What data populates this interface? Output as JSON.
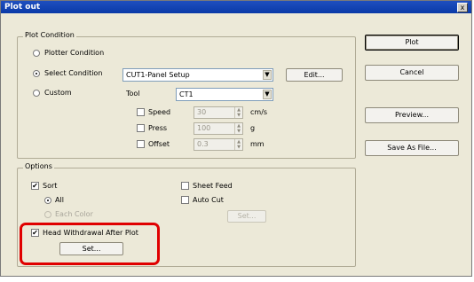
{
  "window": {
    "title": "Plot out",
    "close_glyph": "x"
  },
  "background_fragments": [
    "t",
    "l"
  ],
  "plot_condition": {
    "legend": "Plot Condition",
    "plotter_condition": "Plotter Condition",
    "select_condition": "Select Condition",
    "custom": "Custom",
    "selected_mode": "Select Condition",
    "condition_value": "CUT1-Panel Setup",
    "edit_button": "Edit...",
    "tool_label": "Tool",
    "tool_value": "CT1",
    "speed_label": "Speed",
    "speed_value": "30",
    "speed_unit": "cm/s",
    "press_label": "Press",
    "press_value": "100",
    "press_unit": "g",
    "offset_label": "Offset",
    "offset_value": "0.3",
    "offset_unit": "mm"
  },
  "options": {
    "legend": "Options",
    "sort_label": "Sort",
    "sort_checked": true,
    "all_label": "All",
    "each_color_label": "Each Color",
    "sheet_feed_label": "Sheet Feed",
    "auto_cut_label": "Auto Cut",
    "set_disabled_label": "Set...",
    "head_withdrawal_label": "Head Withdrawal After Plot",
    "head_withdrawal_checked": true,
    "set_label": "Set..."
  },
  "buttons": {
    "plot": "Plot",
    "cancel": "Cancel",
    "preview": "Preview...",
    "save_as_file": "Save As File..."
  },
  "glyphs": {
    "check": "✔",
    "dropdown": "▼",
    "spin_up": "▲",
    "spin_down": "▼"
  },
  "colors": {
    "highlight": "#e00000",
    "titlebar": "#0a3aa8",
    "dialog_bg": "#ece9d8"
  }
}
